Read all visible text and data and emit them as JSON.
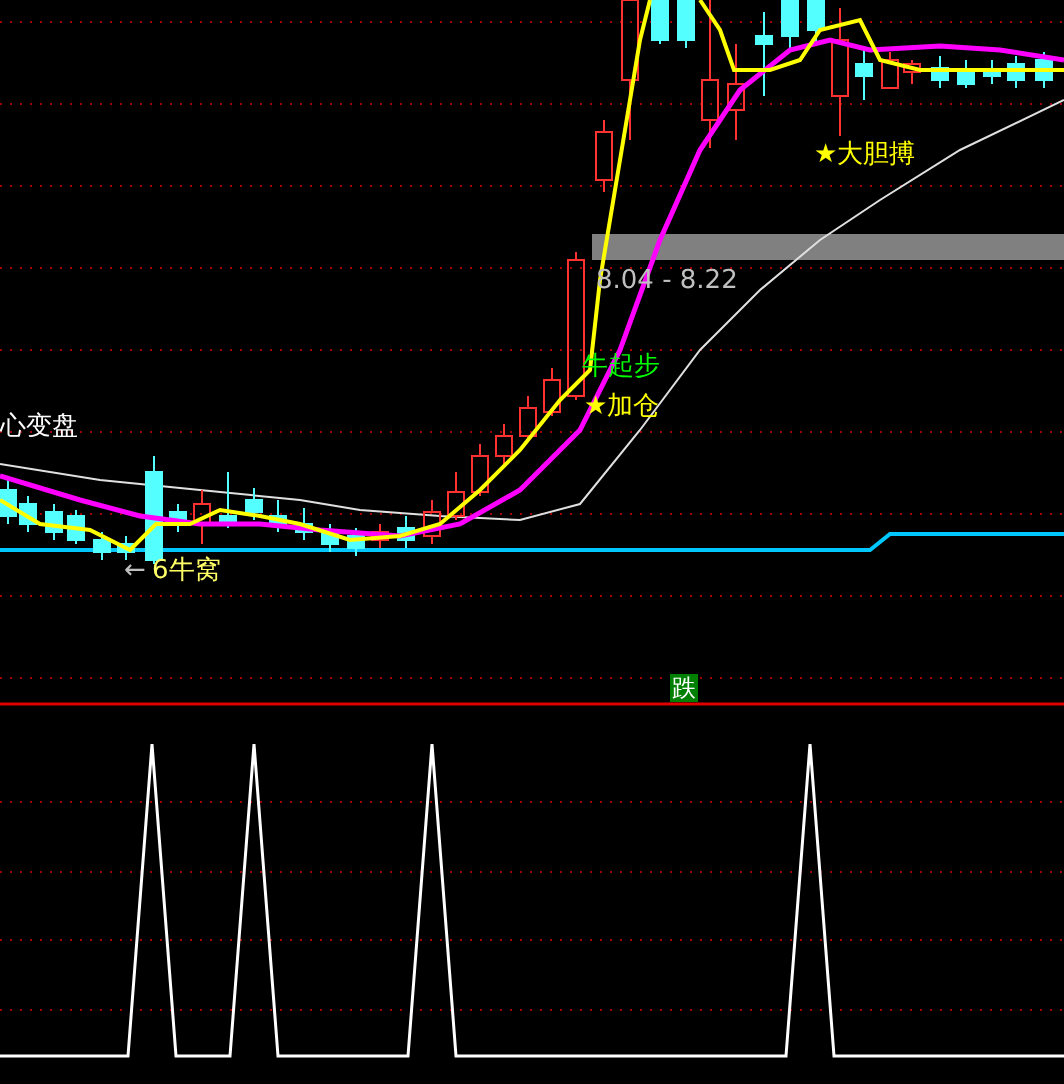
{
  "main_chart": {
    "range_band": {
      "label": "8.04 - 8.22"
    },
    "labels": [
      {
        "text": "心变盘",
        "color": "#ffffff"
      },
      {
        "arrow": "←",
        "text": "6牛窝",
        "color": "#ffff66"
      },
      {
        "text": "牛起步",
        "color": "#00ff00"
      },
      {
        "text": "★加仓",
        "color": "#ffff00"
      },
      {
        "text": "★大胆搏",
        "color": "#ffff00"
      }
    ]
  },
  "signal": {
    "text": "跌",
    "color": "#008000"
  }
}
